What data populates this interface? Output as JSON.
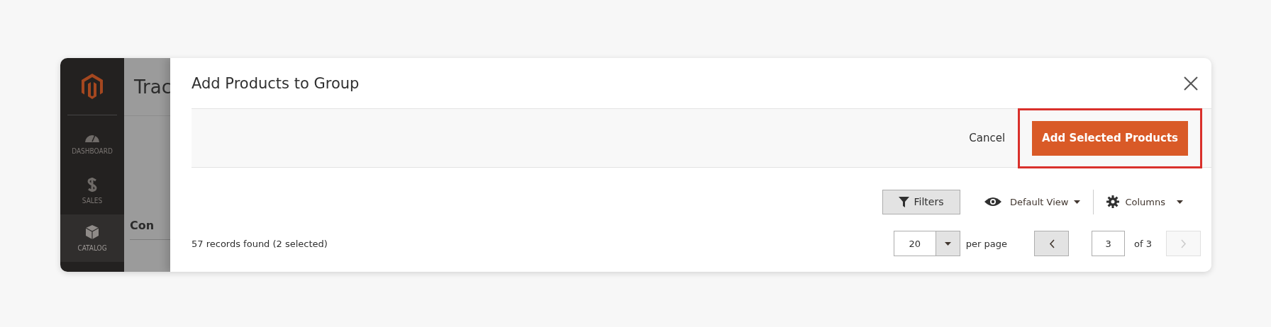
{
  "sidebar": {
    "items": [
      {
        "kind": "dashboard",
        "label": "DASHBOARD",
        "selected": false
      },
      {
        "kind": "sales",
        "label": "SALES",
        "selected": false
      },
      {
        "kind": "catalog",
        "label": "CATALOG",
        "selected": true
      }
    ]
  },
  "background_page": {
    "title": "Trac",
    "section": "Con"
  },
  "modal": {
    "title": "Add Products to Group",
    "actions": {
      "cancel": "Cancel",
      "primary": "Add Selected Products",
      "highlighted": true
    },
    "toolbar": {
      "filters": "Filters",
      "view": "Default View",
      "columns": "Columns"
    },
    "records": "57 records found (2 selected)",
    "pagination": {
      "per_page": "20",
      "per_page_label": "per page",
      "page": "3",
      "of": "of 3",
      "prev_disabled": false,
      "next_disabled": true
    }
  }
}
